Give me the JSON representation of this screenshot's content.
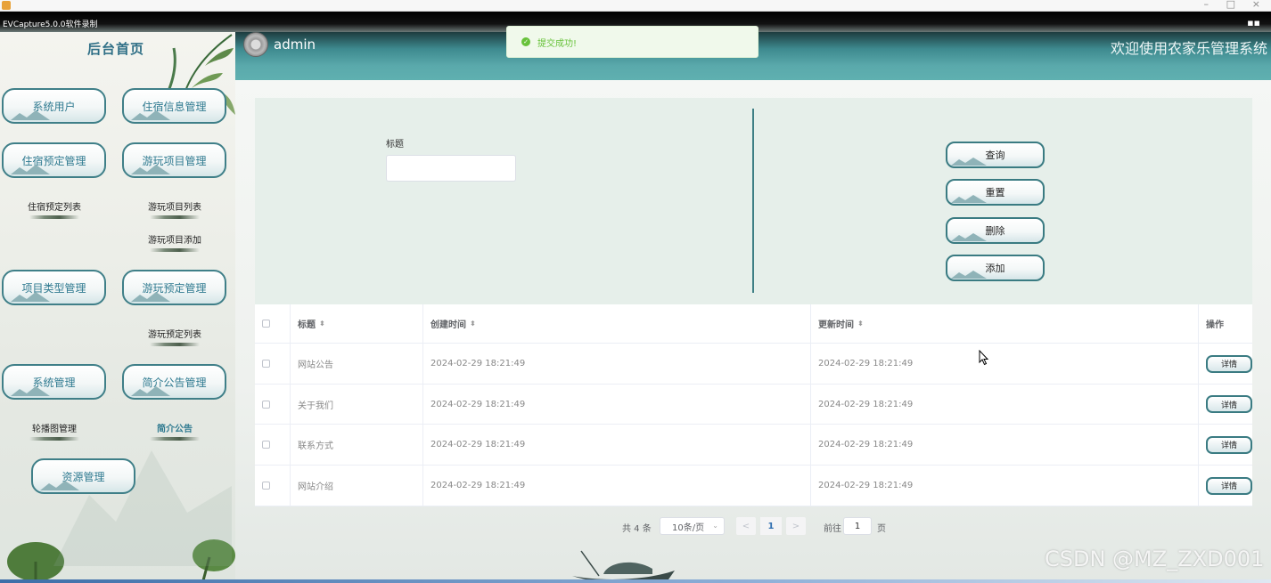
{
  "capture": {
    "title": "EVCapture5.0.0软件录制"
  },
  "sidebar": {
    "title": "后台首页",
    "groups": {
      "system_user": "系统用户",
      "lodging_info": "住宿信息管理",
      "lodging_booking": "住宿预定管理",
      "play_project": "游玩项目管理",
      "project_type": "项目类型管理",
      "play_booking": "游玩预定管理",
      "system_mgmt": "系统管理",
      "intro_notice": "简介公告管理",
      "resource": "资源管理"
    },
    "sub": {
      "lodging_booking_list": "住宿预定列表",
      "play_project_list": "游玩项目列表",
      "play_project_add": "游玩项目添加",
      "play_booking_list": "游玩预定列表",
      "carousel": "轮播图管理",
      "intro_notice": "简介公告"
    }
  },
  "header": {
    "user": "admin",
    "welcome": "欢迎使用农家乐管理系统"
  },
  "toast": {
    "message": "提交成功!"
  },
  "search": {
    "label": "标题",
    "value": "",
    "buttons": {
      "query": "查询",
      "reset": "重置",
      "delete": "删除",
      "add": "添加"
    }
  },
  "table": {
    "headers": {
      "title": "标题",
      "created": "创建时间",
      "updated": "更新时间",
      "action": "操作"
    },
    "rows": [
      {
        "title": "网站公告",
        "created": "2024-02-29 18:21:49",
        "updated": "2024-02-29 18:21:49",
        "action": "详情"
      },
      {
        "title": "关于我们",
        "created": "2024-02-29 18:21:49",
        "updated": "2024-02-29 18:21:49",
        "action": "详情"
      },
      {
        "title": "联系方式",
        "created": "2024-02-29 18:21:49",
        "updated": "2024-02-29 18:21:49",
        "action": "详情"
      },
      {
        "title": "网站介绍",
        "created": "2024-02-29 18:21:49",
        "updated": "2024-02-29 18:21:49",
        "action": "详情"
      }
    ]
  },
  "pagination": {
    "total": "共 4 条",
    "page_size": "10条/页",
    "prev": "<",
    "current": "1",
    "next": ">",
    "goto_label": "前往",
    "goto_value": "1",
    "goto_unit": "页"
  },
  "watermark": "CSDN @MZ_ZXD001",
  "colors": {
    "accent": "#3f7f88",
    "header": "#5aa9ab",
    "link": "#2f7a90"
  }
}
